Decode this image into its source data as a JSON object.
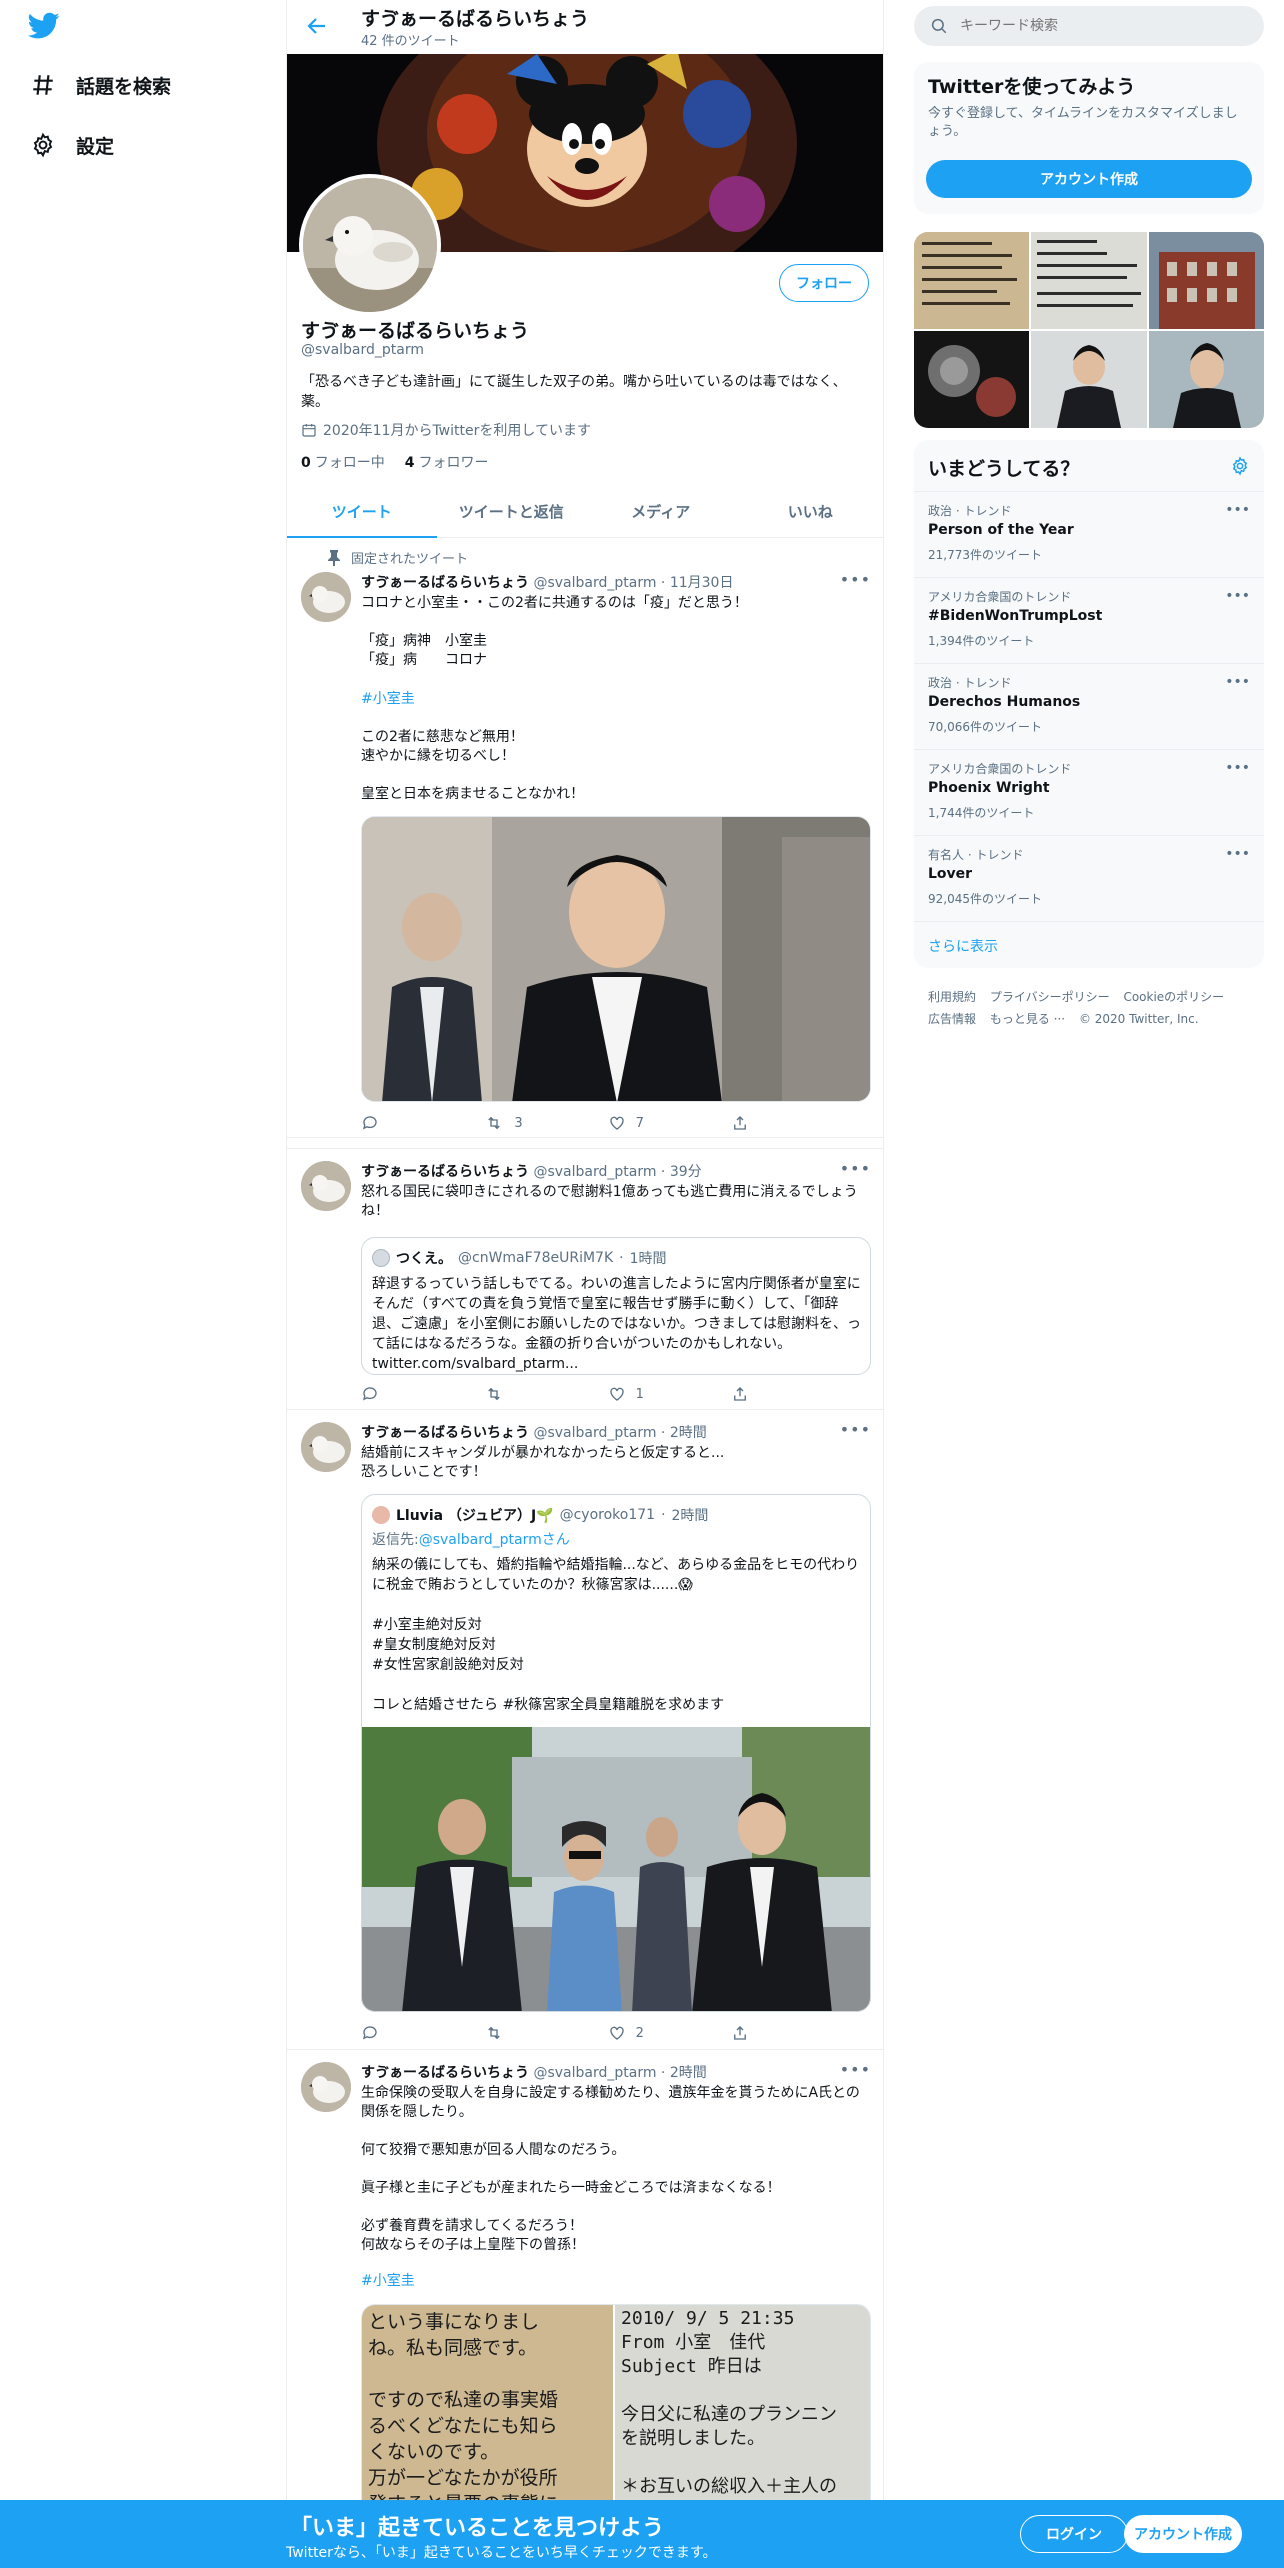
{
  "colors": {
    "accent": "#1da1f2",
    "secondary_text": "#5b7083",
    "text": "#0f1419"
  },
  "nav": {
    "explore": "話題を検索",
    "settings": "設定"
  },
  "header": {
    "title": "すゔぁーるばるらいちょう",
    "tweet_count": "42 件のツイート"
  },
  "profile": {
    "name": "すゔぁーるばるらいちょう",
    "handle": "@svalbard_ptarm",
    "bio": "「恐るべき子ども達計画」にて誕生した双子の弟。嘴から吐いているのは毒ではなく、薬。",
    "joined": "2020年11月からTwitterを利用しています",
    "following_count": "0",
    "following_label": "フォロー中",
    "followers_count": "4",
    "followers_label": "フォロワー",
    "follow_button": "フォロー"
  },
  "tabs": [
    "ツイート",
    "ツイートと返信",
    "メディア",
    "いいね"
  ],
  "pinned_label": "固定されたツイート",
  "tweets": [
    {
      "name": "すゔぁーるばるらいちょう",
      "handle": "@svalbard_ptarm",
      "time": "11月30日",
      "text_a": "コロナと小室圭・・この2者に共通するのは「疫」だと思う！\n\n「疫」病神　小室圭\n「疫」病　　コロナ",
      "hashtag": "#小室圭",
      "text_b": "この2者に慈悲など無用！\n速やかに縁を切るべし！\n\n皇室と日本を病ませることなかれ！",
      "reply": "",
      "retweet": "3",
      "like": "7"
    },
    {
      "name": "すゔぁーるばるらいちょう",
      "handle": "@svalbard_ptarm",
      "time": "39分",
      "text": "怒れる国民に袋叩きにされるので慰謝料1億あっても逃亡費用に消えるでしょうね！",
      "quote": {
        "name": "つくえ。",
        "handle": "@cnWmaF78eURiM7K",
        "time": "1時間",
        "text": "辞退するっていう話しもでてる。わいの進言したように宮内庁関係者が皇室にそんだ（すべての責を負う覚悟で皇室に報告せず勝手に動く）して、「御辞退、ご遠慮」を小室側にお願いしたのではないか。つきましては慰謝料を、って話にはなるだろうな。金額の折り合いがついたのかもしれない。",
        "link": "twitter.com/svalbard_ptarm..."
      },
      "reply": "",
      "retweet": "",
      "like": "1"
    },
    {
      "name": "すゔぁーるばるらいちょう",
      "handle": "@svalbard_ptarm",
      "time": "2時間",
      "text": "結婚前にスキャンダルが暴かれなかったらと仮定すると...\n恐ろしいことです！",
      "quote": {
        "name": "Lluvia （ジュビア）J🌱",
        "handle": "@cyoroko171",
        "time": "2時間",
        "reply_to_label": "返信先: ",
        "reply_to": "@svalbard_ptarmさん",
        "text": "納采の儀にしても、婚約指輪や結婚指輪...など、あらゆる金品をヒモの代わりに税金で賄おうとしていたのか？秋篠宮家は......😱\n\n#小室圭絶対反対\n#皇女制度絶対反対\n#女性宮家創設絶対反対\n\nコレと結婚させたら #秋篠宮家全員皇籍離脱を求めます"
      },
      "reply": "",
      "retweet": "",
      "like": "2"
    },
    {
      "name": "すゔぁーるばるらいちょう",
      "handle": "@svalbard_ptarm",
      "time": "2時間",
      "text": "生命保険の受取人を自身に設定する様勧めたり、遺族年金を貰うためにA氏との関係を隠したり。\n\n何て狡猾で悪知恵が回る人間なのだろう。\n\n眞子様と圭に子どもが産まれたら一時金どころでは済まなくなる！\n\n必ず養育費を請求してくるだろう！\n何故ならその子は上皇陛下の曾孫！",
      "hashtag": "#小室圭",
      "img_left_text": "という事になりまし\nね。私も同感です。\n\nですので私達の事実婚\nるべくどなたにも知ら\nくないのです。\n万が一どなたかが役所\n発すると最悪の事態に\nかねません。",
      "img_right_text": "2010/ 9/ 5 21:35\nFrom 小室　佳代\nSubject 昨日は\n\n今日父に私達のプランニン\nを説明しました。\n\n＊お互いの総収入＋主人の\n遺族年金でお互いの生活を"
    }
  ],
  "search": {
    "placeholder": "キーワード検索"
  },
  "signup_card": {
    "title": "Twitterを使ってみよう",
    "desc": "今すぐ登録して、タイムラインをカスタマイズしましょう。",
    "button": "アカウント作成"
  },
  "trends": {
    "title": "いまどうしてる？",
    "items": [
      {
        "context": "政治 · トレンド",
        "topic": "Person of the Year",
        "count": "21,773件のツイート"
      },
      {
        "context": "アメリカ合衆国のトレンド",
        "topic": "#BidenWonTrumpLost",
        "count": "1,394件のツイート"
      },
      {
        "context": "政治 · トレンド",
        "topic": "Derechos Humanos",
        "count": "70,066件のツイート"
      },
      {
        "context": "アメリカ合衆国のトレンド",
        "topic": "Phoenix Wright",
        "count": "1,744件のツイート"
      },
      {
        "context": "有名人 · トレンド",
        "topic": "Lover",
        "count": "92,045件のツイート"
      }
    ],
    "show_more": "さらに表示"
  },
  "footer": {
    "links": [
      "利用規約",
      "プライバシーポリシー",
      "Cookieのポリシー",
      "広告情報",
      "もっと見る ···"
    ],
    "copyright": "© 2020 Twitter, Inc."
  },
  "bottom_bar": {
    "headline": "「いま」起きていることを見つけよう",
    "sub": "Twitterなら、「いま」起きていることをいち早くチェックできます。",
    "login": "ログイン",
    "signup": "アカウント作成"
  }
}
